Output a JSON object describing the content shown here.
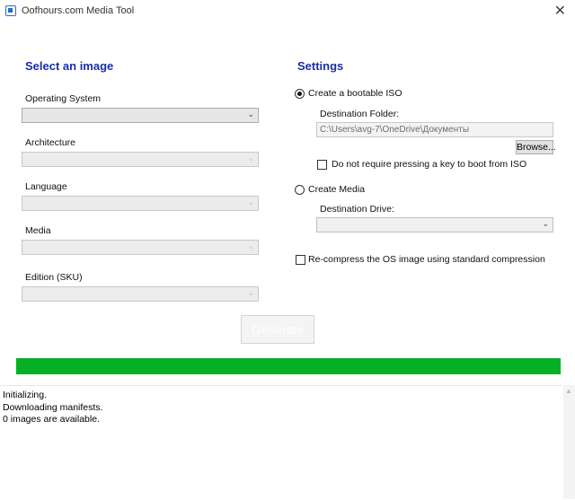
{
  "window": {
    "title": "Oofhours.com Media Tool"
  },
  "select_image": {
    "heading": "Select an image",
    "fields": [
      {
        "label": "Operating System",
        "value": ""
      },
      {
        "label": "Architecture",
        "value": ""
      },
      {
        "label": "Language",
        "value": ""
      },
      {
        "label": "Media",
        "value": ""
      },
      {
        "label": "Edition (SKU)",
        "value": ""
      }
    ]
  },
  "settings": {
    "heading": "Settings",
    "iso_option": "Create a bootable ISO",
    "destination_folder_label": "Destination Folder:",
    "destination_folder_value": "C:\\Users\\avg-7\\OneDrive\\Документы",
    "browse_label": "Browse...",
    "no_keypress_label": "Do not require pressing a key to boot from ISO",
    "media_option": "Create Media",
    "destination_drive_label": "Destination Drive:",
    "recompress_label": "Re-compress the OS image using standard compression"
  },
  "generate_label": "Generate",
  "progress": {
    "value": 1.0,
    "color": "#06b025"
  },
  "log": [
    "Initializing.",
    "Downloading manifests.",
    "0 images are available."
  ]
}
